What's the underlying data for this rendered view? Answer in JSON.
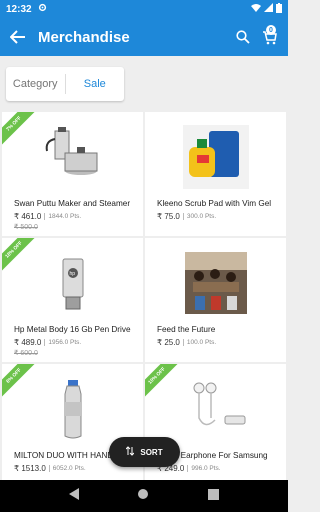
{
  "status": {
    "time": "12:32"
  },
  "header": {
    "title": "Merchandise",
    "cart_count": "0"
  },
  "tabs": {
    "category": "Category",
    "sale": "Sale"
  },
  "products": [
    {
      "name": "Swan Puttu Maker and Steamer",
      "price": "₹ 461.0",
      "points": "1844.0 Pts.",
      "old_price": "₹ 500.0",
      "discount": "7% OFF",
      "image": "puttu-maker"
    },
    {
      "name": "Kleeno Scrub Pad with Vim Gel",
      "price": "₹ 75.0",
      "points": "300.0 Pts.",
      "old_price": "",
      "discount": "",
      "image": "scrub-pad"
    },
    {
      "name": "Hp Metal Body 16 Gb Pen Drive",
      "price": "₹ 489.0",
      "points": "1956.0 Pts.",
      "old_price": "₹ 600.0",
      "discount": "18% OFF",
      "image": "pen-drive"
    },
    {
      "name": "Feed the Future",
      "price": "₹ 25.0",
      "points": "100.0 Pts.",
      "old_price": "",
      "discount": "",
      "image": "feed-the-future"
    },
    {
      "name": "MILTON DUO WITH HAND",
      "price": "₹ 1513.0",
      "points": "6052.0 Pts.",
      "old_price": "",
      "discount": "6% OFF",
      "image": "bottle"
    },
    {
      "name": "Wired Earphone For Samsung",
      "price": "₹ 249.0",
      "points": "996.0 Pts.",
      "old_price": "",
      "discount": "10% OFF",
      "image": "earphone"
    }
  ],
  "sort": {
    "label": "SORT"
  },
  "colors": {
    "primary": "#1e88d9",
    "ribbon": "#6cc24a"
  }
}
